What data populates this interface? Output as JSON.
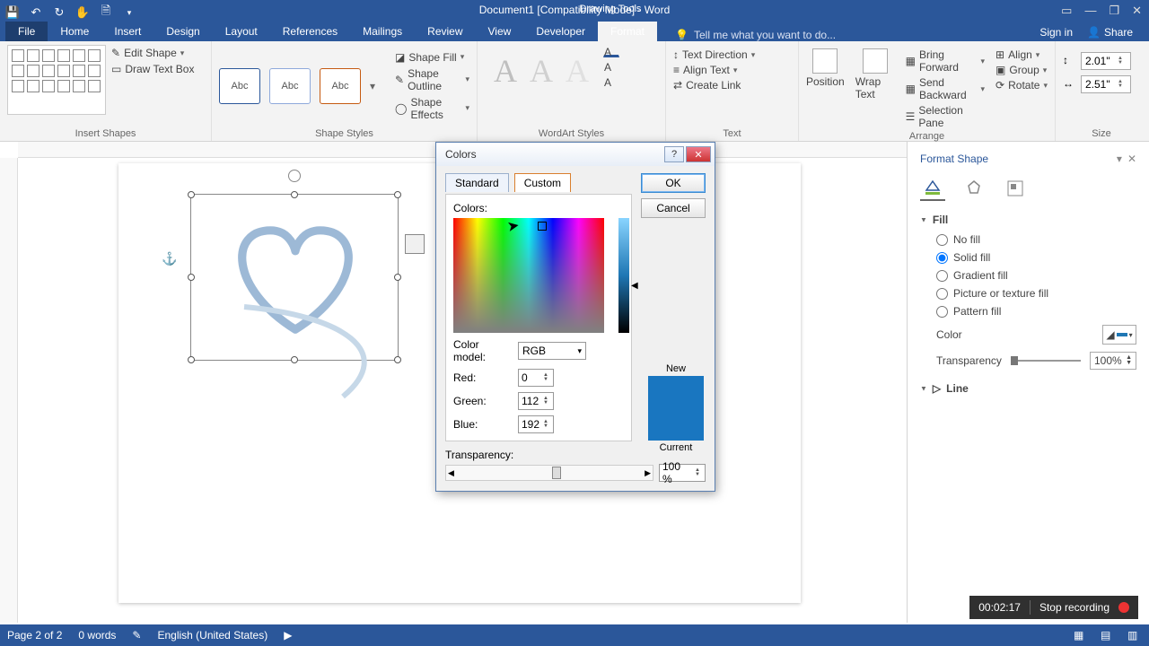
{
  "titlebar": {
    "doc_title": "Document1 [Compatibility Mode] - Word",
    "contextual_title": "Drawing Tools"
  },
  "tabs": {
    "file": "File",
    "items": [
      "Home",
      "Insert",
      "Design",
      "Layout",
      "References",
      "Mailings",
      "Review",
      "View",
      "Developer"
    ],
    "contextual": "Format",
    "tellme_placeholder": "Tell me what you want to do...",
    "signin": "Sign in",
    "share": "Share"
  },
  "ribbon": {
    "insert_shapes": {
      "edit_shape": "Edit Shape",
      "draw_textbox": "Draw Text Box",
      "label": "Insert Shapes"
    },
    "shape_styles": {
      "thumb_text": "Abc",
      "fill": "Shape Fill",
      "outline": "Shape Outline",
      "effects": "Shape Effects",
      "label": "Shape Styles"
    },
    "wordart": {
      "label": "WordArt Styles"
    },
    "text": {
      "direction": "Text Direction",
      "align": "Align Text",
      "link": "Create Link",
      "label": "Text"
    },
    "arrange": {
      "position": "Position",
      "wrap": "Wrap Text",
      "forward": "Bring Forward",
      "backward": "Send Backward",
      "selpane": "Selection Pane",
      "align": "Align",
      "group": "Group",
      "rotate": "Rotate",
      "label": "Arrange"
    },
    "size": {
      "height": "2.01\"",
      "width": "2.51\"",
      "label": "Size"
    }
  },
  "dialog": {
    "title": "Colors",
    "tab_standard": "Standard",
    "tab_custom": "Custom",
    "ok": "OK",
    "cancel": "Cancel",
    "colors_label": "Colors:",
    "color_model_label": "Color model:",
    "color_model_value": "RGB",
    "red_label": "Red:",
    "red_value": "0",
    "green_label": "Green:",
    "green_value": "112",
    "blue_label": "Blue:",
    "blue_value": "192",
    "transparency_label": "Transparency:",
    "transparency_value": "100 %",
    "new_label": "New",
    "current_label": "Current"
  },
  "pane": {
    "title": "Format Shape",
    "fill": "Fill",
    "no_fill": "No fill",
    "solid_fill": "Solid fill",
    "gradient_fill": "Gradient fill",
    "picture_fill": "Picture or texture fill",
    "pattern_fill": "Pattern fill",
    "color_label": "Color",
    "transparency_label": "Transparency",
    "transparency_value": "100%",
    "line": "Line"
  },
  "status": {
    "page": "Page 2 of 2",
    "words": "0 words",
    "lang": "English (United States)"
  },
  "recorder": {
    "time": "00:02:17",
    "stop": "Stop recording"
  }
}
